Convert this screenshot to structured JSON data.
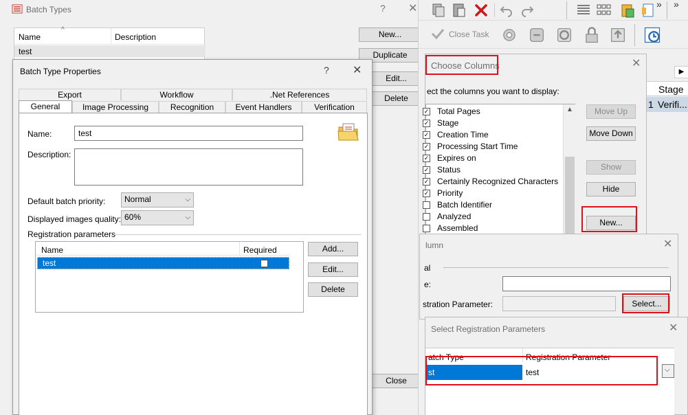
{
  "batch_types": {
    "title": "Batch Types",
    "help": "?",
    "close": "✕",
    "columns": [
      "Name",
      "Description"
    ],
    "rows": [
      {
        "name": "test",
        "description": ""
      }
    ],
    "buttons": {
      "new": "New...",
      "duplicate": "Duplicate",
      "edit": "Edit...",
      "delete": "Delete",
      "close": "Close"
    }
  },
  "props": {
    "title": "Batch Type Properties",
    "help": "?",
    "close": "✕",
    "tabs_top": [
      "Export",
      "Workflow",
      ".Net References"
    ],
    "tabs_bottom": [
      "General",
      "Image Processing",
      "Recognition",
      "Event Handlers",
      "Verification"
    ],
    "name_label": "Name:",
    "name_value": "test",
    "description_label": "Description:",
    "description_value": "",
    "priority_label": "Default batch priority:",
    "priority_value": "Normal",
    "quality_label": "Displayed images quality:",
    "quality_value": "60%",
    "reg_params_label": "Registration parameters",
    "reg_columns": [
      "Name",
      "Required"
    ],
    "reg_rows": [
      {
        "name": "test",
        "required": false
      }
    ],
    "buttons": {
      "add": "Add...",
      "edit": "Edit...",
      "delete": "Delete"
    }
  },
  "toolbar": {
    "close_task": "Close Task",
    "chevron": "»"
  },
  "right_grid": {
    "header": "Stage",
    "row_num": "1",
    "row_value": "Verifi..."
  },
  "choose_columns": {
    "title": "Choose Columns",
    "close": "✕",
    "instruction": "ect the columns you want to display:",
    "items": [
      {
        "label": "Total Pages",
        "checked": true
      },
      {
        "label": "Stage",
        "checked": true
      },
      {
        "label": "Creation Time",
        "checked": true
      },
      {
        "label": "Processing Start Time",
        "checked": true
      },
      {
        "label": "Expires on",
        "checked": true
      },
      {
        "label": "Status",
        "checked": true
      },
      {
        "label": "Certainly Recognized Characters",
        "checked": true
      },
      {
        "label": "Priority",
        "checked": true
      },
      {
        "label": "Batch Identifier",
        "checked": false
      },
      {
        "label": "Analyzed",
        "checked": false
      },
      {
        "label": "Assembled",
        "checked": false
      }
    ],
    "buttons": {
      "move_up": "Move Up",
      "move_down": "Move Down",
      "show": "Show",
      "hide": "Hide",
      "new": "New..."
    }
  },
  "column_dialog": {
    "title": "lumn",
    "close": "✕",
    "group_label": "al",
    "name_label": "e:",
    "name_value": "",
    "reg_param_label": "stration Parameter:",
    "reg_param_value": "",
    "select_btn": "Select..."
  },
  "select_reg": {
    "title": "Select Registration Parameters",
    "close": "✕",
    "columns": [
      "atch Type",
      "Registration Parameter"
    ],
    "row": {
      "batch_type": "st",
      "reg_param": "test"
    }
  }
}
